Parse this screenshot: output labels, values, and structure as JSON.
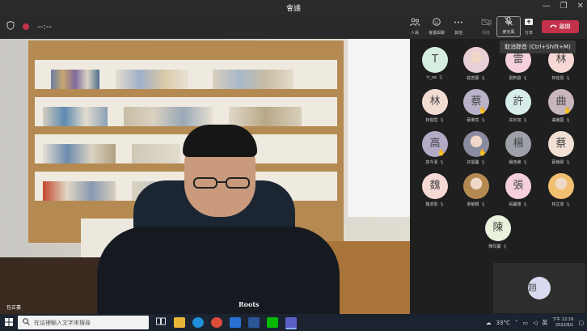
{
  "window": {
    "title": "會議",
    "min_icon": "—",
    "restore_icon": "❐",
    "close_icon": "✕"
  },
  "toolbar": {
    "timer": "--:--",
    "people_label": "人員",
    "react_label": "會議與聊",
    "more_label": "其他",
    "camera_label": "相機",
    "mic_label": "麥克風",
    "share_label": "分享",
    "leave_label": "離開"
  },
  "tooltip": "取消靜音 (Ctrl+Shift+M)",
  "video": {
    "speaker_name": "包正豪",
    "shirt_text": "Roots"
  },
  "participants": [
    {
      "initial": "T",
      "name": "tr_oe",
      "color": "#d5eedf",
      "photo": false,
      "raised": false
    },
    {
      "initial": "",
      "name": "莊若蕾",
      "color": "#e9cfd6",
      "photo": true,
      "raised": false
    },
    {
      "initial": "雷",
      "name": "雷軒諭",
      "color": "#f5d0dc",
      "photo": false,
      "raised": false
    },
    {
      "initial": "林",
      "name": "林佳恩",
      "color": "#f6d9d4",
      "photo": false,
      "raised": false
    },
    {
      "initial": "林",
      "name": "林俊陞",
      "color": "#f3ddd3",
      "photo": false,
      "raised": false
    },
    {
      "initial": "蔡",
      "name": "蔡秉亮",
      "color": "#b9b2c9",
      "photo": false,
      "raised": true
    },
    {
      "initial": "許",
      "name": "許妙如",
      "color": "#d8ecea",
      "photo": false,
      "raised": false
    },
    {
      "initial": "曲",
      "name": "曲繼蓉",
      "color": "#c8b6bd",
      "photo": false,
      "raised": true
    },
    {
      "initial": "高",
      "name": "高今潔",
      "color": "#b3aac6",
      "photo": false,
      "raised": true
    },
    {
      "initial": "",
      "name": "許曼馨",
      "color": "#8a8aa0",
      "photo": true,
      "raised": true
    },
    {
      "initial": "楊",
      "name": "楊逸維",
      "color": "#9ea0a8",
      "photo": false,
      "raised": false
    },
    {
      "initial": "蔡",
      "name": "蔡翰霖",
      "color": "#f1e0d3",
      "photo": false,
      "raised": false
    },
    {
      "initial": "魏",
      "name": "魏淯恩",
      "color": "#f6d9d4",
      "photo": false,
      "raised": false
    },
    {
      "initial": "",
      "name": "黃郁鋼",
      "color": "#b58a52",
      "photo": true,
      "raised": false
    },
    {
      "initial": "張",
      "name": "張馨雅",
      "color": "#f5d0dc",
      "photo": false,
      "raised": false
    },
    {
      "initial": "",
      "name": "林芷菲",
      "color": "#f0c070",
      "photo": true,
      "raised": false
    },
    {
      "initial": "陳",
      "name": "陳玟馨",
      "color": "#e8f2dc",
      "photo": false,
      "raised": false
    }
  ],
  "self_view": {
    "initial": "趙"
  },
  "taskbar": {
    "search_placeholder": "在這裡輸入文字來搜尋",
    "weather": "33°C",
    "lang": "英",
    "time": "下午 12:16",
    "date": "2022/6/1"
  }
}
